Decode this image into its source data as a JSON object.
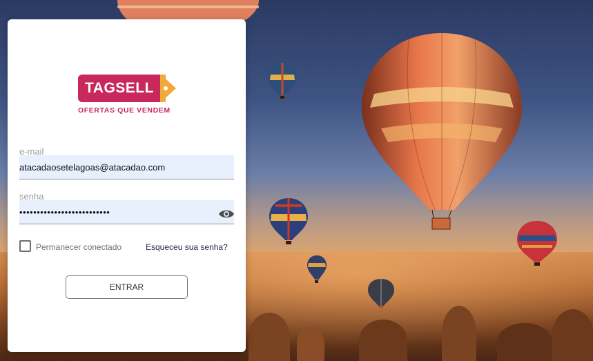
{
  "brand": {
    "name": "TAGSELL",
    "tagline": "OFERTAS QUE VENDEM",
    "primary_color": "#c8285c",
    "accent_color": "#f0a93a"
  },
  "login": {
    "email_label": "e-mail",
    "email_value": "atacadaosetelagoas@atacadao.com",
    "password_label": "senha",
    "password_mask": "••••••••••••••••••••••••••",
    "remember_label": "Permanecer conectado",
    "remember_checked": false,
    "forgot_label": "Esqueceu sua senha?",
    "submit_label": "ENTRAR"
  },
  "icons": {
    "password_toggle": "eye-icon"
  }
}
